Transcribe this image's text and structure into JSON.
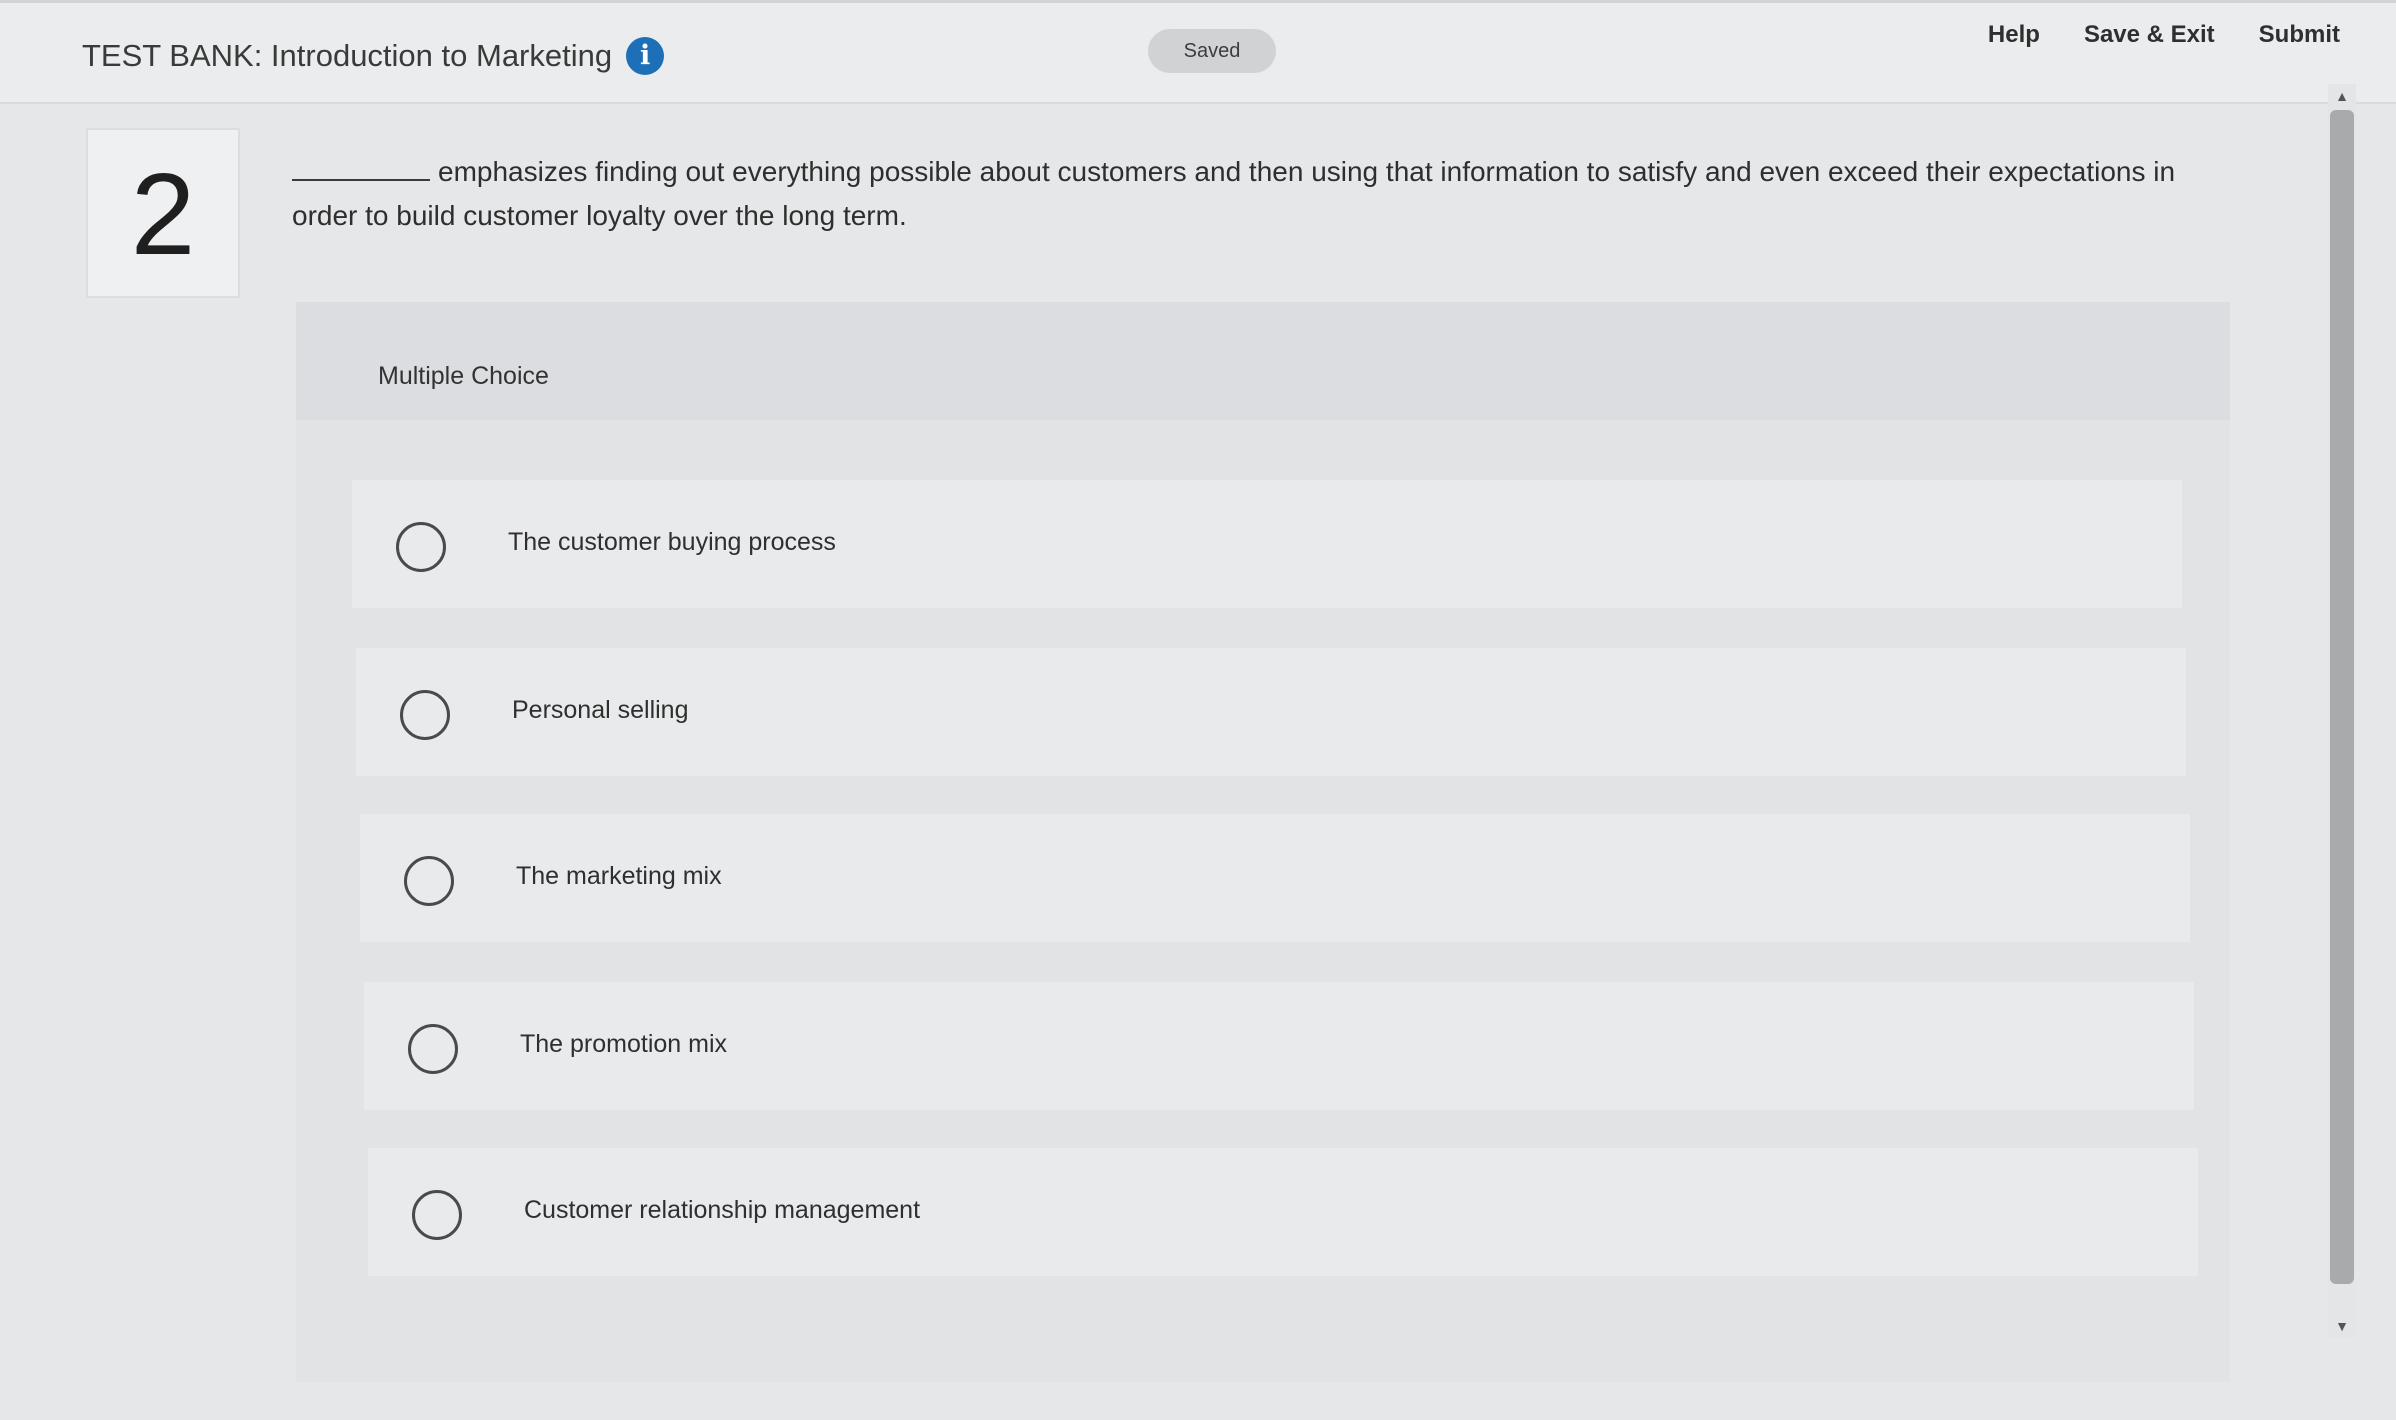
{
  "header": {
    "title": "TEST BANK: Introduction to Marketing",
    "info_icon": "i",
    "saved": "Saved",
    "actions": [
      "Help",
      "Save & Exit",
      "Submit"
    ]
  },
  "question": {
    "number": "2",
    "text": "emphasizes finding out everything possible about customers and then using that information to satisfy and even exceed their expectations in order to build customer loyalty over the long term.",
    "type_label": "Multiple Choice",
    "options": [
      "The customer buying process",
      "Personal selling",
      "The marketing mix",
      "The promotion mix",
      "Customer relationship management"
    ]
  },
  "scrollbar": {
    "up_icon": "▲",
    "down_icon": "▼"
  }
}
